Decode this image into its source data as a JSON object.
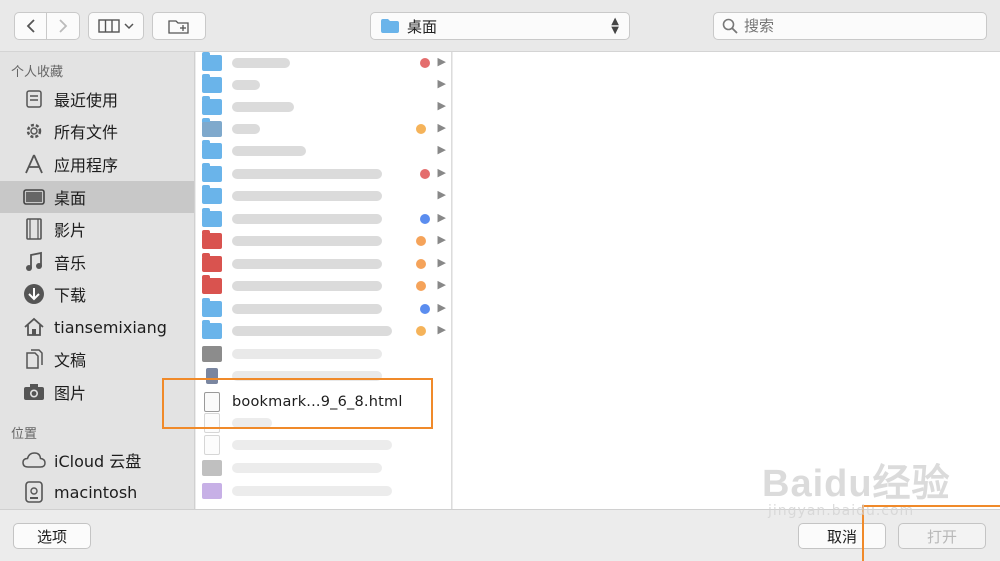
{
  "toolbar": {
    "back_icon": "chevron-left-icon",
    "forward_icon": "chevron-right-icon",
    "view_icon": "column-view-icon",
    "new_folder_icon": "new-folder-icon",
    "location_label": "桌面",
    "search_placeholder": "搜索"
  },
  "sidebar": {
    "favorites_header": "个人收藏",
    "favorites": [
      {
        "label": "最近使用",
        "icon": "recents-icon"
      },
      {
        "label": "所有文件",
        "icon": "all-files-gear-icon"
      },
      {
        "label": "应用程序",
        "icon": "applications-icon"
      },
      {
        "label": "桌面",
        "icon": "desktop-icon",
        "selected": true
      },
      {
        "label": "影片",
        "icon": "movies-icon"
      },
      {
        "label": "音乐",
        "icon": "music-note-icon"
      },
      {
        "label": "下载",
        "icon": "downloads-icon"
      },
      {
        "label": "tiansemixiang",
        "icon": "home-icon"
      },
      {
        "label": "文稿",
        "icon": "documents-icon"
      },
      {
        "label": "图片",
        "icon": "camera-icon"
      }
    ],
    "locations_header": "位置",
    "locations": [
      {
        "label": "iCloud 云盘",
        "icon": "cloud-icon"
      },
      {
        "label": "macintosh",
        "icon": "disk-icon"
      }
    ]
  },
  "filelist": {
    "highlighted_file": "bookmark...9_6_8.html"
  },
  "bottombar": {
    "options_label": "选项",
    "cancel_label": "取消",
    "open_label": "打开"
  },
  "colors": {
    "highlight": "#f08a2a",
    "folder_blue": "#6ab4ea",
    "folder_red": "#d9534f",
    "selected_row": "#c8c8c8"
  },
  "watermark": {
    "logo": "Baidu经验",
    "url": "jingyan.baidu.com"
  }
}
